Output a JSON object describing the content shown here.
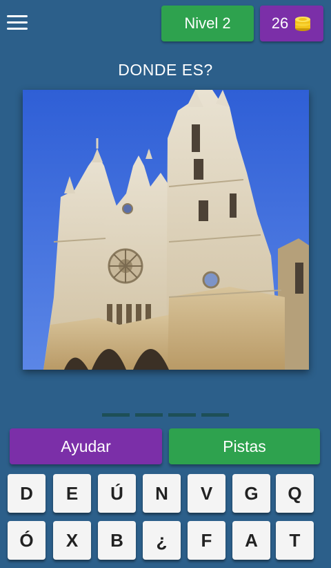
{
  "header": {
    "menu_icon": "hamburger-menu-icon",
    "level_label": "Nivel 2",
    "coins": "26",
    "coin_icon": "coin-stack-icon",
    "level_color": "#2ea24e",
    "coins_color": "#7b2fa8"
  },
  "question": "DONDE ES?",
  "answer_slots": 4,
  "buttons": {
    "help_label": "Ayudar",
    "hints_label": "Pistas"
  },
  "keyboard": {
    "row1": [
      "D",
      "E",
      "Ú",
      "N",
      "V",
      "G",
      "Q"
    ],
    "row2": [
      "Ó",
      "X",
      "B",
      "¿",
      "F",
      "A",
      "T"
    ]
  },
  "colors": {
    "background": "#2c5f8a",
    "purple": "#7b2fa8",
    "green": "#2ea24e",
    "key": "#f4f4f4"
  }
}
